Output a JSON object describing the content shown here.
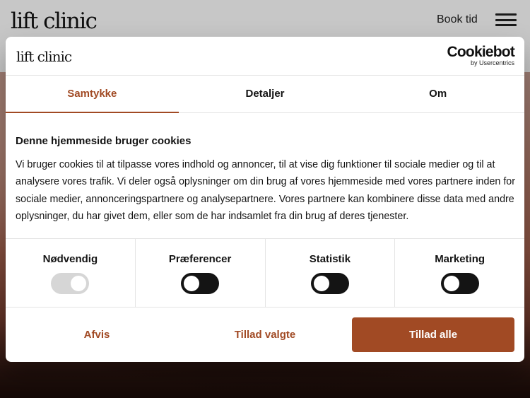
{
  "site": {
    "logo": "lift clinic",
    "book_link": "Book tid"
  },
  "dialog": {
    "logo": "lift clinic",
    "cookiebot_brand": "Cookiebot",
    "cookiebot_sub": "by Usercentrics",
    "tabs": [
      {
        "label": "Samtykke",
        "active": true
      },
      {
        "label": "Detaljer",
        "active": false
      },
      {
        "label": "Om",
        "active": false
      }
    ],
    "title": "Denne hjemmeside bruger cookies",
    "body": "Vi bruger cookies til at tilpasse vores indhold og annoncer, til at vise dig funktioner til sociale medier og til at analysere vores trafik. Vi deler også oplysninger om din brug af vores hjemmeside med vores partnere inden for sociale medier, annonceringspartnere og analysepartnere. Vores partnere kan kombinere disse data med andre oplysninger, du har givet dem, eller som de har indsamlet fra din brug af deres tjenester.",
    "preferences": [
      {
        "label": "Nødvendig",
        "checked": true,
        "disabled": true
      },
      {
        "label": "Præferencer",
        "checked": false,
        "disabled": false
      },
      {
        "label": "Statistik",
        "checked": false,
        "disabled": false
      },
      {
        "label": "Marketing",
        "checked": false,
        "disabled": false
      }
    ],
    "buttons": {
      "decline": "Afvis",
      "allow_selected": "Tillad valgte",
      "allow_all": "Tillad alle"
    }
  },
  "colors": {
    "accent": "#a14a24",
    "toggle_off": "#141414",
    "toggle_disabled": "#d6d6d6"
  }
}
